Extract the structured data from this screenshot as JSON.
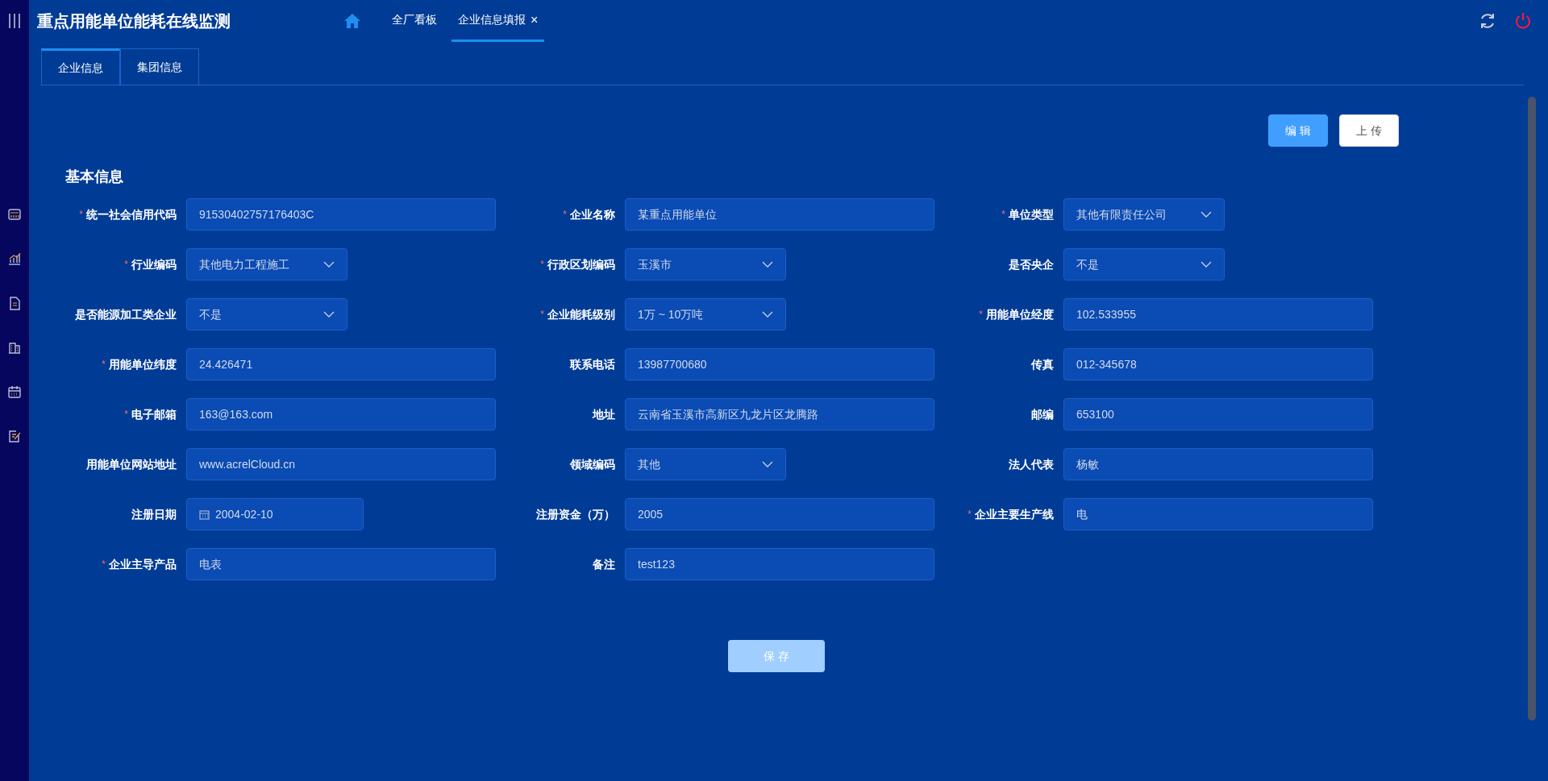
{
  "header": {
    "title": "重点用能单位能耗在线监测",
    "nav_tabs": [
      {
        "label": "全厂看板",
        "selected": false,
        "closable": false
      },
      {
        "label": "企业信息填报",
        "selected": true,
        "closable": true
      }
    ],
    "close_glyph": "×"
  },
  "sub_tabs": [
    {
      "label": "企业信息",
      "selected": true
    },
    {
      "label": "集团信息",
      "selected": false
    }
  ],
  "actions": [
    {
      "label": "编 辑",
      "kind": "primary"
    },
    {
      "label": "上 传",
      "kind": "plain"
    }
  ],
  "section_title": "基本信息",
  "fields": [
    {
      "label": "统一社会信用代码",
      "required": true,
      "kind": "text",
      "value": "91530402757176403C"
    },
    {
      "label": "企业名称",
      "required": true,
      "kind": "text",
      "value": "某重点用能单位"
    },
    {
      "label": "单位类型",
      "required": true,
      "kind": "select",
      "value": "其他有限责任公司"
    },
    {
      "label": "行业编码",
      "required": true,
      "kind": "select",
      "value": "其他电力工程施工"
    },
    {
      "label": "行政区划编码",
      "required": true,
      "kind": "select",
      "value": "玉溪市"
    },
    {
      "label": "是否央企",
      "required": false,
      "kind": "select",
      "value": "不是"
    },
    {
      "label": "是否能源加工类企业",
      "required": false,
      "kind": "select",
      "value": "不是"
    },
    {
      "label": "企业能耗级别",
      "required": true,
      "kind": "select",
      "value": "1万 ~ 10万吨"
    },
    {
      "label": "用能单位经度",
      "required": true,
      "kind": "text",
      "value": "102.533955"
    },
    {
      "label": "用能单位纬度",
      "required": true,
      "kind": "text",
      "value": "24.426471"
    },
    {
      "label": "联系电话",
      "required": false,
      "kind": "text",
      "value": "13987700680"
    },
    {
      "label": "传真",
      "required": false,
      "kind": "text",
      "value": "012-345678"
    },
    {
      "label": "电子邮箱",
      "required": true,
      "kind": "text",
      "value": "163@163.com"
    },
    {
      "label": "地址",
      "required": false,
      "kind": "text",
      "value": "云南省玉溪市高新区九龙片区龙腾路"
    },
    {
      "label": "邮编",
      "required": false,
      "kind": "text",
      "value": "653100"
    },
    {
      "label": "用能单位网站地址",
      "required": false,
      "kind": "text",
      "value": "www.acrelCloud.cn"
    },
    {
      "label": "领域编码",
      "required": false,
      "kind": "select",
      "value": "其他"
    },
    {
      "label": "法人代表",
      "required": false,
      "kind": "text",
      "value": "杨敏"
    },
    {
      "label": "注册日期",
      "required": false,
      "kind": "date",
      "value": "2004-02-10"
    },
    {
      "label": "注册资金（万）",
      "required": false,
      "kind": "text",
      "value": "2005"
    },
    {
      "label": "企业主要生产线",
      "required": true,
      "kind": "text",
      "value": "电"
    },
    {
      "label": "企业主导产品",
      "required": true,
      "kind": "text",
      "value": "电表"
    },
    {
      "label": "备注",
      "required": false,
      "kind": "text",
      "value": "test123"
    }
  ],
  "save_button": {
    "label": "保 存",
    "disabled": true
  },
  "required_mark": "*"
}
